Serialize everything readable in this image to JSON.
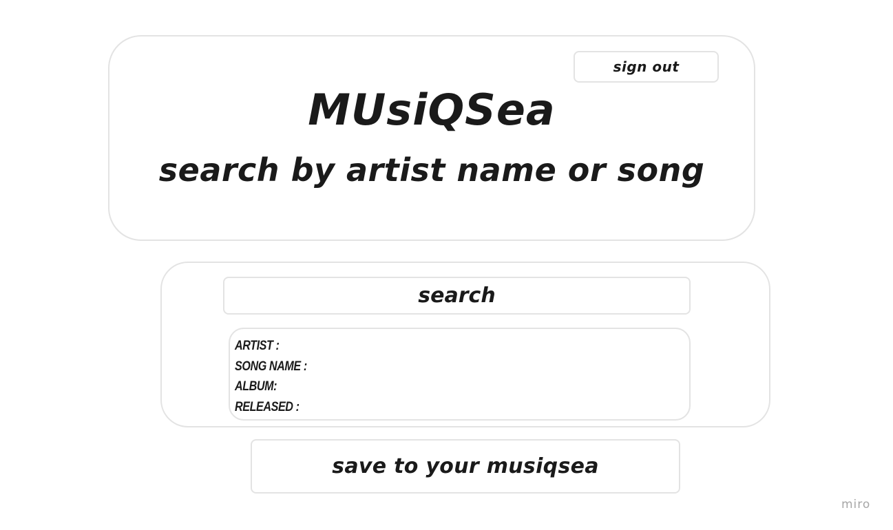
{
  "header": {
    "signout_label": "SIGN OUT",
    "title": "MUsiQSea",
    "subtitle": "SEARCH BY ARTIST NAME OR SONG"
  },
  "search": {
    "input_value": "SEARCH"
  },
  "results": {
    "lines": [
      "ARTIST :",
      "SONG NAME :",
      "ALBUM:",
      "RELEASED :"
    ]
  },
  "save": {
    "label": "save to your MusiQSea"
  },
  "brand": {
    "watermark": "miro"
  },
  "colors": {
    "text": "#1a1a1a",
    "border": "#e3e3e3",
    "watermark": "#a6a6a6",
    "background": "#ffffff"
  }
}
